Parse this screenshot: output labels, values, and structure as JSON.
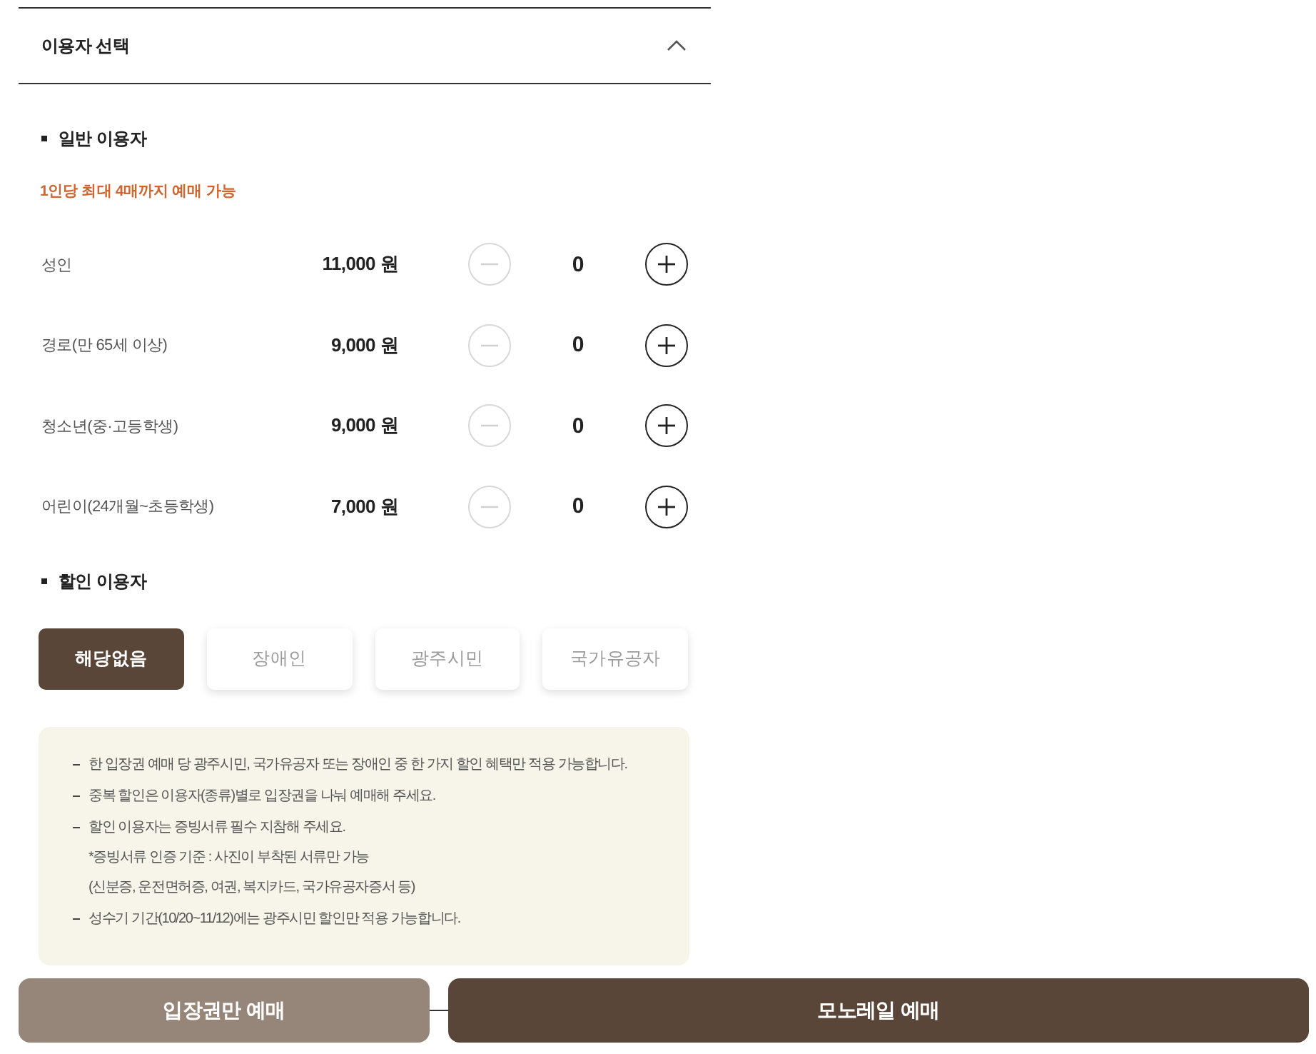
{
  "section": {
    "title": "이용자 선택",
    "expanded": true
  },
  "general": {
    "heading": "일반 이용자",
    "limit_note": "1인당 최대 4매까지 예매 가능",
    "tickets": [
      {
        "label": "성인",
        "price": "11,000 원",
        "count": "0",
        "decrease_disabled": true,
        "increase_disabled": false
      },
      {
        "label": "경로(만 65세 이상)",
        "price": "9,000 원",
        "count": "0",
        "decrease_disabled": true,
        "increase_disabled": false
      },
      {
        "label": "청소년(중·고등학생)",
        "price": "9,000 원",
        "count": "0",
        "decrease_disabled": true,
        "increase_disabled": false
      },
      {
        "label": "어린이(24개월~초등학생)",
        "price": "7,000 원",
        "count": "0",
        "decrease_disabled": true,
        "increase_disabled": false
      }
    ]
  },
  "discount": {
    "heading": "할인 이용자",
    "options": [
      {
        "label": "해당없음",
        "selected": true
      },
      {
        "label": "장애인",
        "selected": false
      },
      {
        "label": "광주시민",
        "selected": false
      },
      {
        "label": "국가유공자",
        "selected": false
      }
    ]
  },
  "notices": [
    {
      "text": "한 입장권 예매 당 광주시민, 국가유공자 또는 장애인 중 한 가지 할인 혜택만 적용 가능합니다."
    },
    {
      "text": "중복 할인은 이용자(종류)별로 입장권을 나눠 예매해 주세요."
    },
    {
      "text": "할인 이용자는 증빙서류 필수 지참해 주세요.",
      "notes": [
        "*증빙서류 인증 기준 : 사진이 부착된 서류만 가능",
        "(신분증, 운전면허증, 여권, 복지카드, 국가유공자증서 등)"
      ]
    },
    {
      "text": "성수기 기간(10/20~11/12)에는 광주시민 할인만 적용 가능합니다."
    }
  ],
  "buttons": [
    {
      "label": "입장권만 예매",
      "kind": "secondary"
    },
    {
      "label": "모노레일 예매",
      "kind": "primary"
    }
  ]
}
